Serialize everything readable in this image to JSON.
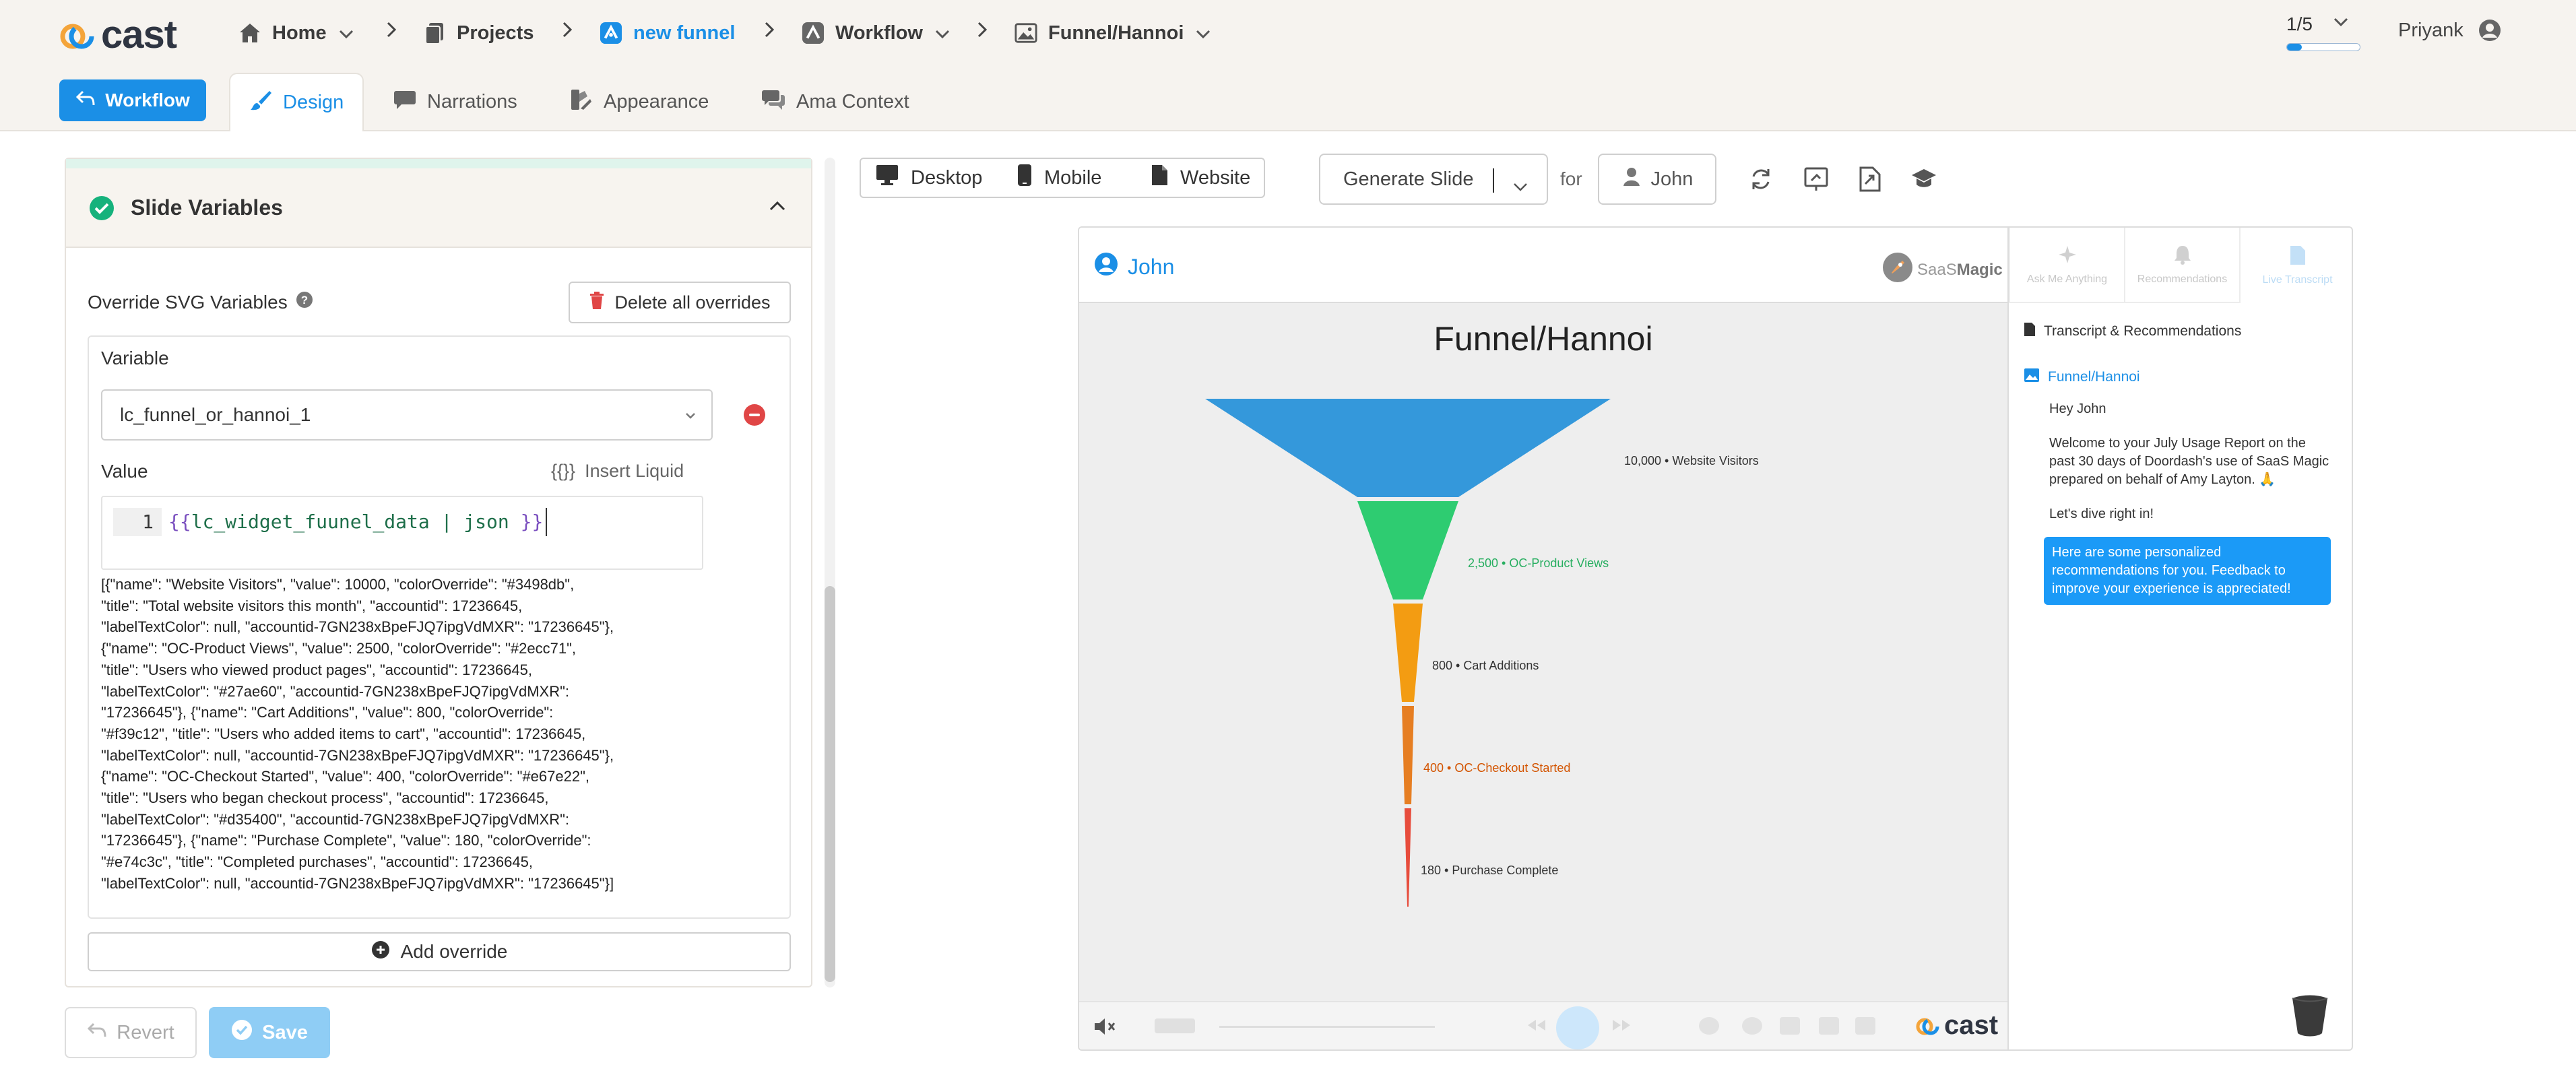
{
  "app": {
    "logo_text": "cast"
  },
  "breadcrumbs": [
    {
      "label": "Home",
      "icon": "home-icon",
      "has_dropdown": true
    },
    {
      "label": "Projects",
      "icon": "projects-icon",
      "has_dropdown": false
    },
    {
      "label": "new funnel",
      "icon": "funnel-app-icon",
      "has_dropdown": false,
      "active": true
    },
    {
      "label": "Workflow",
      "icon": "workflow-icon",
      "has_dropdown": true
    },
    {
      "label": "Funnel/Hannoi",
      "icon": "image-icon",
      "has_dropdown": true
    }
  ],
  "progress": {
    "label": "1/5",
    "fraction": 0.2
  },
  "user": {
    "name": "Priyank"
  },
  "tabs": {
    "workflow_button": "Workflow",
    "items": [
      {
        "label": "Design",
        "icon": "brush-icon",
        "active": true
      },
      {
        "label": "Narrations",
        "icon": "speech-bubble-icon",
        "active": false
      },
      {
        "label": "Appearance",
        "icon": "appearance-icon",
        "active": false
      },
      {
        "label": "Ama Context",
        "icon": "chat-icon",
        "active": false
      }
    ]
  },
  "slide_variables": {
    "title": "Slide Variables",
    "override_label": "Override SVG Variables",
    "delete_all_label": "Delete all overrides",
    "variable_label": "Variable",
    "variable_value": "lc_funnel_or_hannoi_1",
    "value_label": "Value",
    "insert_liquid_label": "Insert Liquid",
    "insert_liquid_icon_text": "{{}}",
    "editor": {
      "line_number": "1",
      "open_brace": "{{",
      "expression": "lc_widget_fuunel_data | json ",
      "close_brace": "}}"
    },
    "json_output": "[{\"name\": \"Website Visitors\", \"value\": 10000, \"colorOverride\": \"#3498db\",\n\"title\": \"Total website visitors this month\", \"accountid\": 17236645,\n\"labelTextColor\": null, \"accountid-7GN238xBpeFJQ7ipgVdMXR\": \"17236645\"},\n{\"name\": \"OC-Product Views\", \"value\": 2500, \"colorOverride\": \"#2ecc71\",\n\"title\": \"Users who viewed product pages\", \"accountid\": 17236645,\n\"labelTextColor\": \"#27ae60\", \"accountid-7GN238xBpeFJQ7ipgVdMXR\":\n\"17236645\"}, {\"name\": \"Cart Additions\", \"value\": 800, \"colorOverride\":\n\"#f39c12\", \"title\": \"Users who added items to cart\", \"accountid\": 17236645,\n\"labelTextColor\": null, \"accountid-7GN238xBpeFJQ7ipgVdMXR\": \"17236645\"},\n{\"name\": \"OC-Checkout Started\", \"value\": 400, \"colorOverride\": \"#e67e22\",\n\"title\": \"Users who began checkout process\", \"accountid\": 17236645,\n\"labelTextColor\": \"#d35400\", \"accountid-7GN238xBpeFJQ7ipgVdMXR\":\n\"17236645\"}, {\"name\": \"Purchase Complete\", \"value\": 180, \"colorOverride\":\n\"#e74c3c\", \"title\": \"Completed purchases\", \"accountid\": 17236645,\n\"labelTextColor\": null, \"accountid-7GN238xBpeFJQ7ipgVdMXR\": \"17236645\"}]",
    "add_override_label": "Add override"
  },
  "footer": {
    "revert_label": "Revert",
    "save_label": "Save"
  },
  "preview_toolbar": {
    "devices": [
      {
        "label": "Desktop",
        "icon": "desktop-icon"
      },
      {
        "label": "Mobile",
        "icon": "mobile-icon"
      },
      {
        "label": "Website",
        "icon": "document-icon"
      }
    ],
    "generate_label": "Generate Slide",
    "for_label": "for",
    "persona": "John",
    "tool_icons": [
      "refresh-icon",
      "present-icon",
      "export-icon",
      "graduation-cap-icon"
    ]
  },
  "preview": {
    "user_name": "John",
    "brand_prefix": "SaaS",
    "brand_suffix": "Magic",
    "slide_title": "Funnel/Hannoi",
    "footer_logo": "cast",
    "side_tabs": [
      {
        "label": "Ask Me Anything",
        "icon": "sparkle-icon",
        "active": false
      },
      {
        "label": "Recommendations",
        "icon": "bell-icon",
        "active": false
      },
      {
        "label": "Live Transcript",
        "icon": "transcript-icon",
        "active": true
      }
    ],
    "transcript_heading": "Transcript & Recommendations",
    "slide_link": "Funnel/Hannoi",
    "greeting": "Hey John",
    "welcome": "Welcome to your July Usage Report on the past 30 days of Doordash's use of SaaS Magic prepared on behalf of Amy Layton. 🙏",
    "dive_in": "Let's dive right in!",
    "recommendation": "Here are some personalized recommendations for you. Feedback to improve your experience is appreciated!"
  },
  "chart_data": {
    "type": "funnel",
    "title": "Funnel/Hannoi",
    "stages": [
      {
        "name": "Website Visitors",
        "value": 10000,
        "value_label": "10,000",
        "color": "#3498db",
        "label_color": "#333333"
      },
      {
        "name": "OC-Product Views",
        "value": 2500,
        "value_label": "2,500",
        "color": "#2ecc71",
        "label_color": "#27ae60"
      },
      {
        "name": "Cart Additions",
        "value": 800,
        "value_label": "800",
        "color": "#f39c12",
        "label_color": "#333333"
      },
      {
        "name": "OC-Checkout Started",
        "value": 400,
        "value_label": "400",
        "color": "#e67e22",
        "label_color": "#d35400"
      },
      {
        "name": "Purchase Complete",
        "value": 180,
        "value_label": "180",
        "color": "#e74c3c",
        "label_color": "#333333"
      }
    ]
  }
}
